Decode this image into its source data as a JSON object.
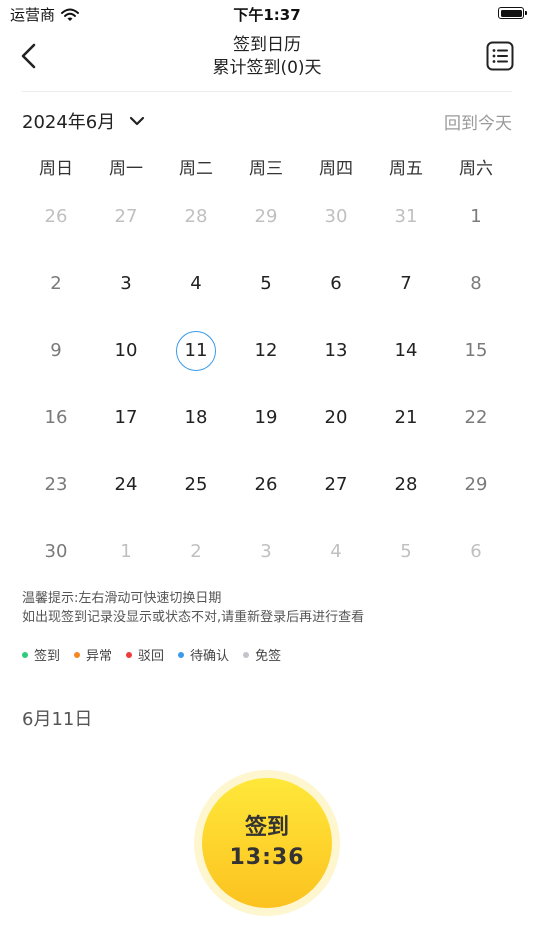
{
  "status_bar": {
    "carrier": "运营商",
    "time": "下午1:37"
  },
  "nav": {
    "title": "签到日历",
    "subtitle": "累计签到(0)天"
  },
  "calendar": {
    "month_label": "2024年6月",
    "today_link": "回到今天",
    "weekdays": [
      "周日",
      "周一",
      "周二",
      "周三",
      "周四",
      "周五",
      "周六"
    ],
    "selected_day": "11",
    "days": [
      "26",
      "27",
      "28",
      "29",
      "30",
      "31",
      "1",
      "2",
      "3",
      "4",
      "5",
      "6",
      "7",
      "8",
      "9",
      "10",
      "11",
      "12",
      "13",
      "14",
      "15",
      "16",
      "17",
      "18",
      "19",
      "20",
      "21",
      "22",
      "23",
      "24",
      "25",
      "26",
      "27",
      "28",
      "29",
      "30",
      "1",
      "2",
      "3",
      "4",
      "5",
      "6"
    ]
  },
  "tips": {
    "line1": "温馨提示:左右滑动可快速切换日期",
    "line2": "如出现签到记录没显示或状态不对,请重新登录后再进行查看"
  },
  "legend": [
    {
      "label": "签到",
      "color": "#2ecb7a"
    },
    {
      "label": "异常",
      "color": "#f5871f"
    },
    {
      "label": "驳回",
      "color": "#ee3b3b"
    },
    {
      "label": "待确认",
      "color": "#3a9bea"
    },
    {
      "label": "免签",
      "color": "#c4c4cc"
    }
  ],
  "selected_date_heading": "6月11日",
  "checkin": {
    "label": "签到",
    "time": "13:36"
  },
  "colors": {
    "accent": "#3a9bea",
    "checkin_button": "#fcc21f"
  }
}
